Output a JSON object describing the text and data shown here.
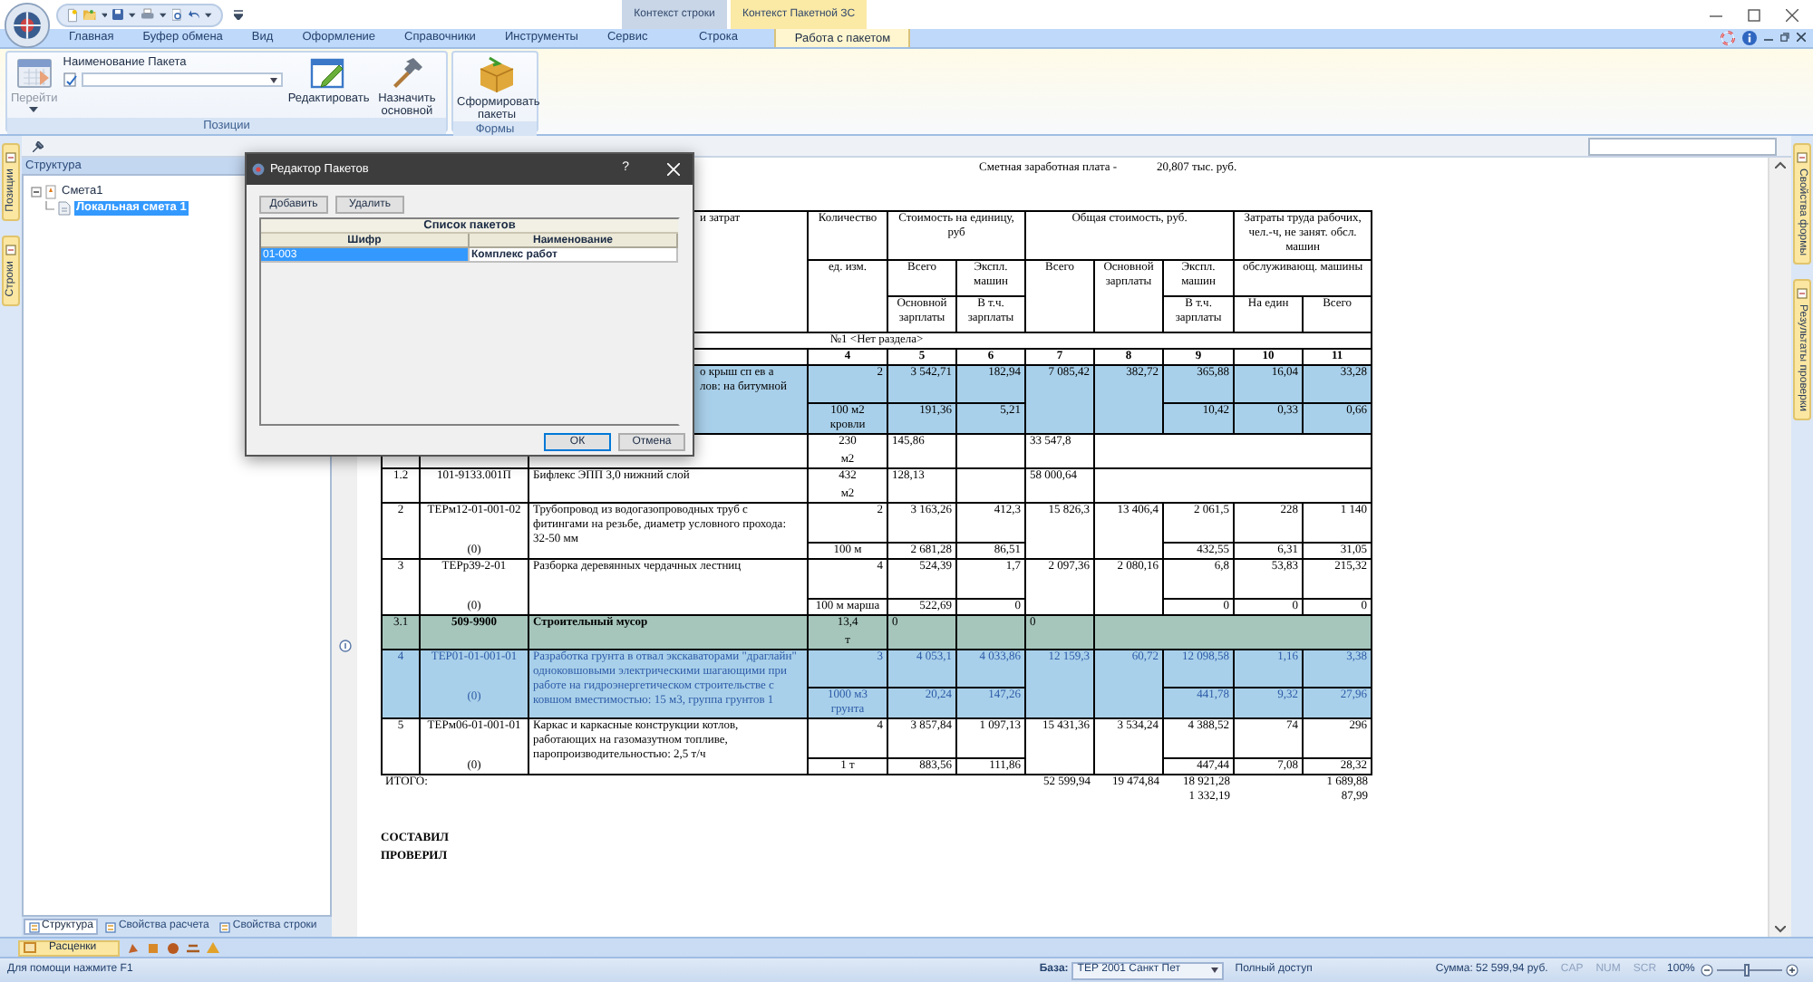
{
  "title_bar": {
    "context_tabs": [
      {
        "label": "Контекст строки",
        "color": "#c8d6e8"
      },
      {
        "label": "Контекст Пакетной ЗС",
        "color": "#fbe9a6"
      }
    ]
  },
  "ribbon": {
    "tabs": [
      {
        "label": "Главная",
        "selected": false
      },
      {
        "label": "Буфер обмена",
        "selected": false
      },
      {
        "label": "Вид",
        "selected": false
      },
      {
        "label": "Оформление",
        "selected": false
      },
      {
        "label": "Справочники",
        "selected": false
      },
      {
        "label": "Инструменты",
        "selected": false
      },
      {
        "label": "Сервис",
        "selected": false
      },
      {
        "label": "Строка",
        "selected": false
      },
      {
        "label": "Работа с пакетом",
        "selected": true
      }
    ],
    "groups": [
      {
        "label": "Позиции",
        "controls": [
          {
            "kind": "large",
            "label": "Перейти",
            "disabled": true
          },
          {
            "kind": "combo",
            "label": "Наименование Пакета"
          },
          {
            "kind": "large",
            "label": "Редактировать",
            "disabled": false
          },
          {
            "kind": "large",
            "label": "Назначить основной",
            "disabled": false
          }
        ]
      },
      {
        "label": "Формы",
        "controls": [
          {
            "kind": "large",
            "label": "Сформировать пакеты",
            "disabled": false
          }
        ]
      }
    ]
  },
  "left_strip": {
    "tabs": [
      {
        "label": "Позиции"
      },
      {
        "label": "Строки"
      }
    ]
  },
  "right_strip": {
    "tabs": [
      {
        "label": "Свойства формы"
      },
      {
        "label": "Результаты проверки"
      }
    ]
  },
  "structure_panel": {
    "title": "Структура",
    "tree": [
      {
        "label": "Смета1",
        "expanded": true,
        "selected": false,
        "children": [
          {
            "label": "Локальная смета 1",
            "selected": true
          }
        ]
      }
    ],
    "tabs": [
      {
        "label": "Структура",
        "selected": true
      },
      {
        "label": "Свойства расчета",
        "selected": false
      },
      {
        "label": "Свойства строки",
        "selected": false
      }
    ]
  },
  "bottom_bar": {
    "tab": "Расценки"
  },
  "document": {
    "summary_label": "Сметная заработная плата -",
    "summary_value": "20,807 тыс. руб.",
    "header": {
      "name": "и затрат",
      "qty": "Количество",
      "unit": "ед. изм.",
      "unit_cost": "Стоимость на единицу, руб",
      "unit_cost_all": "Всего",
      "unit_cost_machines": "Экспл. машин",
      "unit_cost_wage": "Основной зарплаты",
      "unit_cost_mach_wage": "В т.ч. зарплаты",
      "total": "Общая стоимость, руб.",
      "total_all": "Всего",
      "total_wage": "Основной зарплаты",
      "total_machines": "Экспл. машин",
      "total_mach_wage": "В т.ч. зарплаты",
      "labor": "Затраты труда рабочих, чел.-ч, не занят. обсл. машин",
      "labor_machines": "обслуживающ. машины",
      "labor_unit": "На един",
      "labor_all": "Всего"
    },
    "section": "№1 <Нет раздела>",
    "col_numbers": [
      "4",
      "5",
      "6",
      "7",
      "8",
      "9",
      "10",
      "11"
    ],
    "rows": [
      {
        "kind": "item",
        "color": "#a9d0ea",
        "selected": false,
        "name": "о крыш сп ев а\nлов: на битумной",
        "qty": "2",
        "unit": "100 м2 кровли",
        "unit_cost": [
          "3 542,71",
          "182,94"
        ],
        "unit_wage": [
          "191,36",
          "5,21"
        ],
        "total": "7 085,42",
        "total_wage": "382,72",
        "total_mach": [
          "365,88",
          "10,42"
        ],
        "labor": [
          "16,04",
          "33,28"
        ],
        "labor_mach": [
          "0,33",
          "0,66"
        ]
      },
      {
        "kind": "resource",
        "selected": false,
        "qty": "230",
        "unit": "м2",
        "unit_cost": "145,86",
        "total": "33 547,8"
      },
      {
        "kind": "resource",
        "selected": false,
        "num": "1.2",
        "code": "101-9133.001П",
        "name": "Бифлекс ЭПП 3,0 нижний слой",
        "qty": "432",
        "unit": "м2",
        "unit_cost": "128,13",
        "total": "58 000,64"
      },
      {
        "kind": "item",
        "selected": false,
        "num": "2",
        "code": "ТЕРм12-01-001-02",
        "sub": "(0)",
        "name": "Трубопровод из водогазопроводных труб с фитингами на резьбе, диаметр условного прохода: 32-50 мм",
        "qty": "2",
        "unit": "100 м",
        "unit_cost": [
          "3 163,26",
          "412,3"
        ],
        "unit_wage": [
          "2 681,28",
          "86,51"
        ],
        "total": "15 826,3",
        "total_wage": "13 406,4",
        "total_mach": [
          "2 061,5",
          "432,55"
        ],
        "labor": [
          "228",
          "1 140"
        ],
        "labor_mach": [
          "6,31",
          "31,05"
        ]
      },
      {
        "kind": "item",
        "selected": false,
        "num": "3",
        "code": "ТЕРр39-2-01",
        "sub": "(0)",
        "name": "Разборка деревянных чердачных лестниц",
        "qty": "4",
        "unit": "100 м марша",
        "unit_cost": [
          "524,39",
          "1,7"
        ],
        "unit_wage": [
          "522,69",
          "0"
        ],
        "total": "2 097,36",
        "total_wage": "2 080,16",
        "total_mach": [
          "6,8",
          "0"
        ],
        "labor": [
          "53,83",
          "215,32"
        ],
        "labor_mach": [
          "0",
          "0"
        ]
      },
      {
        "kind": "resource",
        "color": "#a6c6bc",
        "selected": false,
        "bold": true,
        "num": "3.1",
        "code": "509-9900",
        "name": "Строительный мусор",
        "qty": "13,4",
        "unit": "т",
        "unit_cost": "0",
        "total": "0"
      },
      {
        "kind": "item",
        "color": "#a9d0ea",
        "selected": true,
        "num": "4",
        "code": "ТЕР01-01-001-01",
        "sub": "(0)",
        "name": "Разработка грунта в отвал экскаваторами \"драглайн\" одноковшовыми электрическими шагающими при работе на гидроэнергетическом строительстве с ковшом вместимостью: 15 м3, группа грунтов 1",
        "qty": "3",
        "unit": "1000 м3 грунта",
        "unit_cost": [
          "4 053,1",
          "4 033,86"
        ],
        "unit_wage": [
          "20,24",
          "147,26"
        ],
        "total": "12 159,3",
        "total_wage": "60,72",
        "total_mach": [
          "12 098,58",
          "441,78"
        ],
        "labor": [
          "1,16",
          "3,38"
        ],
        "labor_mach": [
          "9,32",
          "27,96"
        ]
      },
      {
        "kind": "item",
        "selected": false,
        "num": "5",
        "code": "ТЕРм06-01-001-01",
        "sub": "(0)",
        "name": "Каркас и каркасные конструкции котлов, работающих на газомазутном топливе, паропроизводительностью: 2,5 т/ч",
        "qty": "4",
        "unit": "1 т",
        "unit_cost": [
          "3 857,84",
          "1 097,13"
        ],
        "unit_wage": [
          "883,56",
          "111,86"
        ],
        "total": "15 431,36",
        "total_wage": "3 534,24",
        "total_mach": [
          "4 388,52",
          "447,44"
        ],
        "labor": [
          "74",
          "296"
        ],
        "labor_mach": [
          "7,08",
          "28,32"
        ]
      }
    ],
    "totals": {
      "label": "ИТОГО:",
      "total": "52 599,94",
      "total_wage": "19 474,84",
      "total_mach": [
        "18 921,28",
        "1 332,19"
      ],
      "labor": [
        "1 689,88",
        "87,99"
      ]
    },
    "signatures": [
      "СОСТАВИЛ",
      "ПРОВЕРИЛ"
    ]
  },
  "dialog": {
    "title": "Редактор Пакетов",
    "help": "?",
    "top_buttons": [
      "Добавить",
      "Удалить"
    ],
    "caption": "Список пакетов",
    "columns": [
      "Шифр",
      "Наименование"
    ],
    "rows": [
      {
        "cells": [
          "01-003",
          "Комплекс работ"
        ],
        "selected": true
      }
    ],
    "buttons": [
      {
        "label": "ОК",
        "default": true
      },
      {
        "label": "Отмена",
        "default": false
      }
    ]
  },
  "status_bar": {
    "help": "Для помощи нажмите F1",
    "base_label": "База:",
    "base_value": "ТЕР 2001 Санкт Пет",
    "access": "Полный доступ",
    "sum": "Сумма: 52 599,94 руб.",
    "indicators": [
      "CAP",
      "NUM",
      "SCR"
    ],
    "zoom": "100%",
    "zoom_slider": {
      "level": 0.45
    }
  }
}
